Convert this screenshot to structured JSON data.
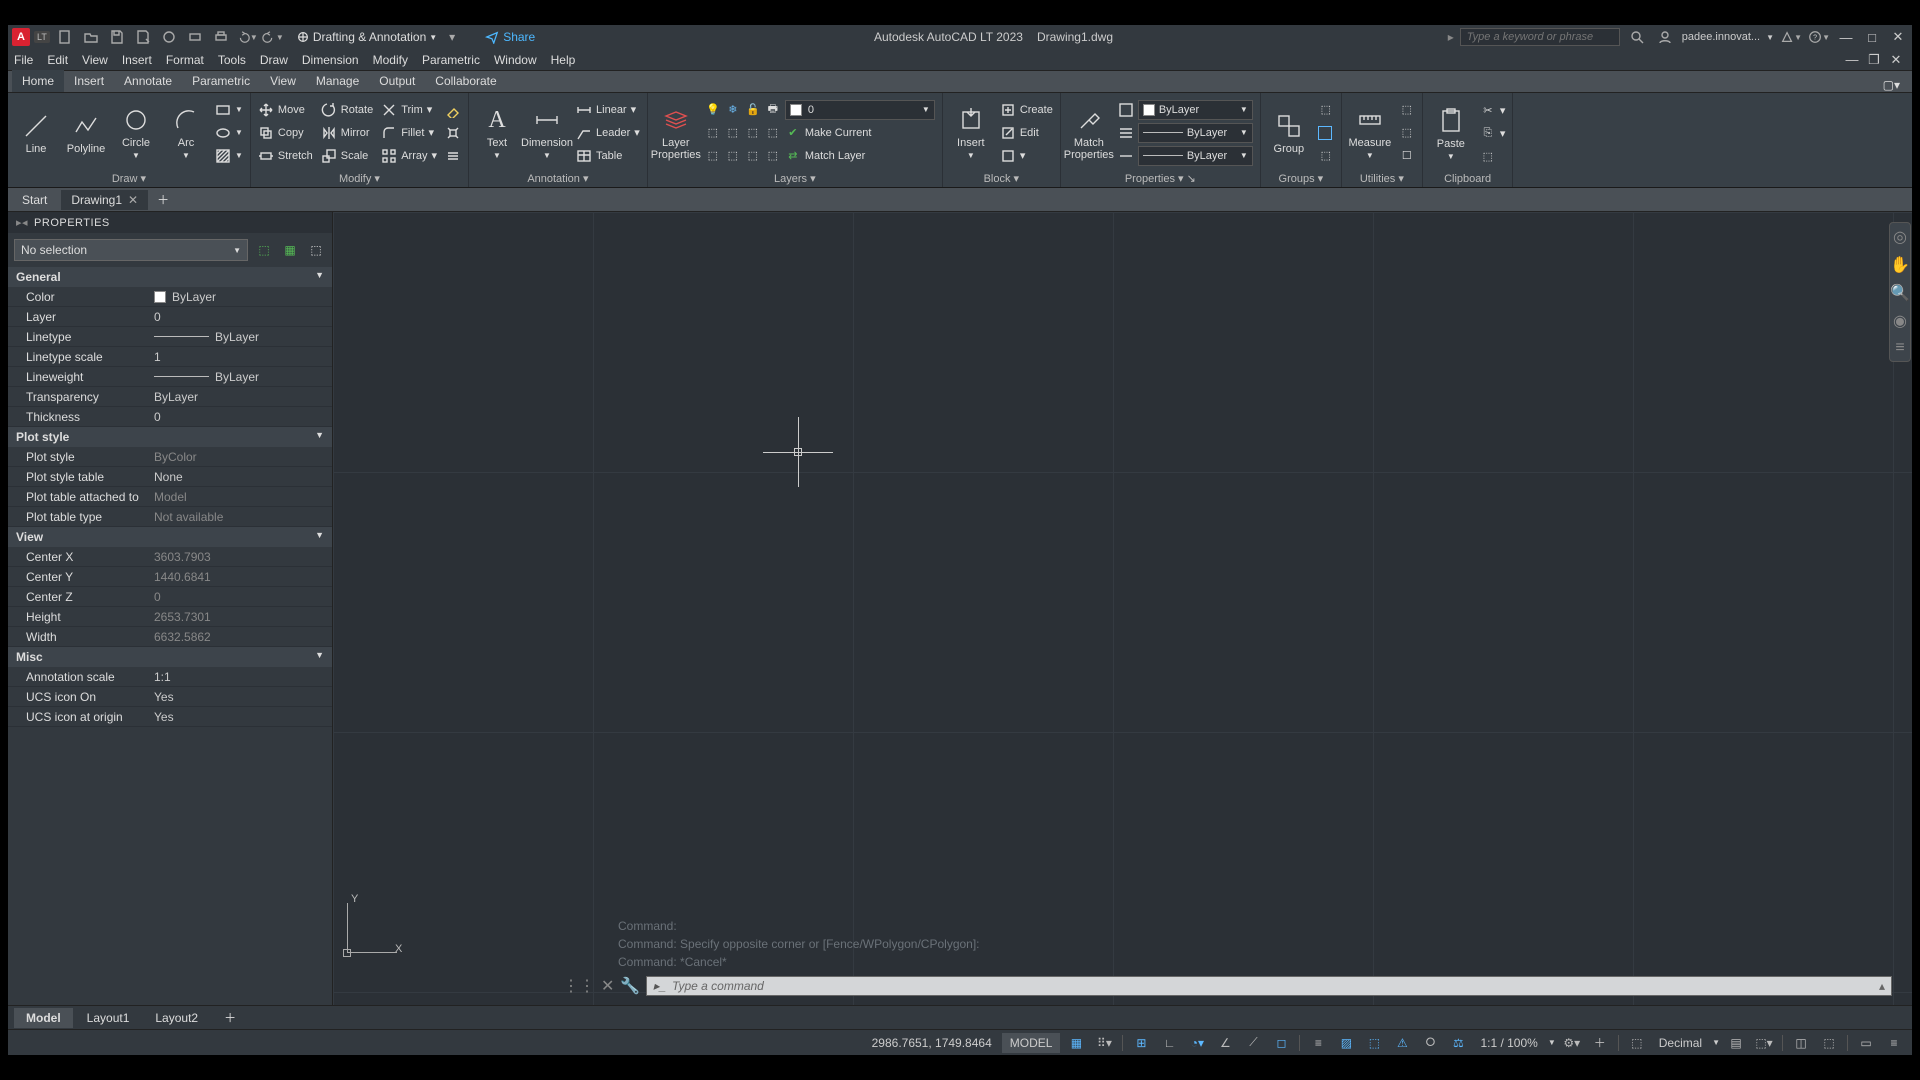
{
  "app": {
    "title_app": "Autodesk AutoCAD LT 2023",
    "title_file": "Drawing1.dwg",
    "workspace": "Drafting & Annotation",
    "share": "Share",
    "search_ph": "Type a keyword or phrase",
    "user": "padee.innovat..."
  },
  "menus": [
    "File",
    "Edit",
    "View",
    "Insert",
    "Format",
    "Tools",
    "Draw",
    "Dimension",
    "Modify",
    "Parametric",
    "Window",
    "Help"
  ],
  "ribbon_tabs": [
    "Home",
    "Insert",
    "Annotate",
    "Parametric",
    "View",
    "Manage",
    "Output",
    "Collaborate"
  ],
  "draw": {
    "line": "Line",
    "polyline": "Polyline",
    "circle": "Circle",
    "arc": "Arc",
    "title": "Draw"
  },
  "modify": {
    "move": "Move",
    "rotate": "Rotate",
    "trim": "Trim",
    "copy": "Copy",
    "mirror": "Mirror",
    "fillet": "Fillet",
    "stretch": "Stretch",
    "scale": "Scale",
    "array": "Array",
    "title": "Modify"
  },
  "annotation": {
    "text": "Text",
    "dimension": "Dimension",
    "linear": "Linear",
    "leader": "Leader",
    "table": "Table",
    "title": "Annotation"
  },
  "layers": {
    "lp": "Layer\nProperties",
    "current": "0",
    "make_current": "Make Current",
    "match": "Match Layer",
    "title": "Layers"
  },
  "block": {
    "insert": "Insert",
    "create": "Create",
    "edit": "Edit",
    "title": "Block"
  },
  "props_panel": {
    "match": "Match\nProperties",
    "bylayer": "ByLayer",
    "title": "Properties"
  },
  "groups": {
    "group": "Group",
    "title": "Groups"
  },
  "utilities": {
    "measure": "Measure",
    "title": "Utilities"
  },
  "clipboard": {
    "paste": "Paste",
    "title": "Clipboard"
  },
  "file_tabs": {
    "start": "Start",
    "drawing": "Drawing1"
  },
  "palette": {
    "title": "PROPERTIES",
    "selection": "No selection",
    "cats": {
      "general": "General",
      "plot": "Plot style",
      "view": "View",
      "misc": "Misc"
    },
    "general": [
      {
        "k": "Color",
        "v": "ByLayer",
        "sw": "#ffffff"
      },
      {
        "k": "Layer",
        "v": "0"
      },
      {
        "k": "Linetype",
        "v": "ByLayer",
        "line": true
      },
      {
        "k": "Linetype scale",
        "v": "1"
      },
      {
        "k": "Lineweight",
        "v": "ByLayer",
        "line": true
      },
      {
        "k": "Transparency",
        "v": "ByLayer"
      },
      {
        "k": "Thickness",
        "v": "0"
      }
    ],
    "plot": [
      {
        "k": "Plot style",
        "v": "ByColor",
        "dim": true
      },
      {
        "k": "Plot style table",
        "v": "None"
      },
      {
        "k": "Plot table attached to",
        "v": "Model",
        "dim": true
      },
      {
        "k": "Plot table type",
        "v": "Not available",
        "dim": true
      }
    ],
    "view": [
      {
        "k": "Center X",
        "v": "3603.7903",
        "dim": true
      },
      {
        "k": "Center Y",
        "v": "1440.6841",
        "dim": true
      },
      {
        "k": "Center Z",
        "v": "0",
        "dim": true
      },
      {
        "k": "Height",
        "v": "2653.7301",
        "dim": true
      },
      {
        "k": "Width",
        "v": "6632.5862",
        "dim": true
      }
    ],
    "misc": [
      {
        "k": "Annotation scale",
        "v": "1:1"
      },
      {
        "k": "UCS icon On",
        "v": "Yes"
      },
      {
        "k": "UCS icon at origin",
        "v": "Yes"
      }
    ]
  },
  "cmd": {
    "h1": "Command:",
    "h2": "Command: Specify opposite corner or [Fence/WPolygon/CPolygon]:",
    "h3": "Command: *Cancel*",
    "ph": "Type a command"
  },
  "layout_tabs": [
    "Model",
    "Layout1",
    "Layout2"
  ],
  "status": {
    "coords": "2986.7651, 1749.8464",
    "model": "MODEL",
    "scale": "1:1 / 100%",
    "units": "Decimal"
  },
  "ucs": {
    "y": "Y",
    "x": "X"
  }
}
